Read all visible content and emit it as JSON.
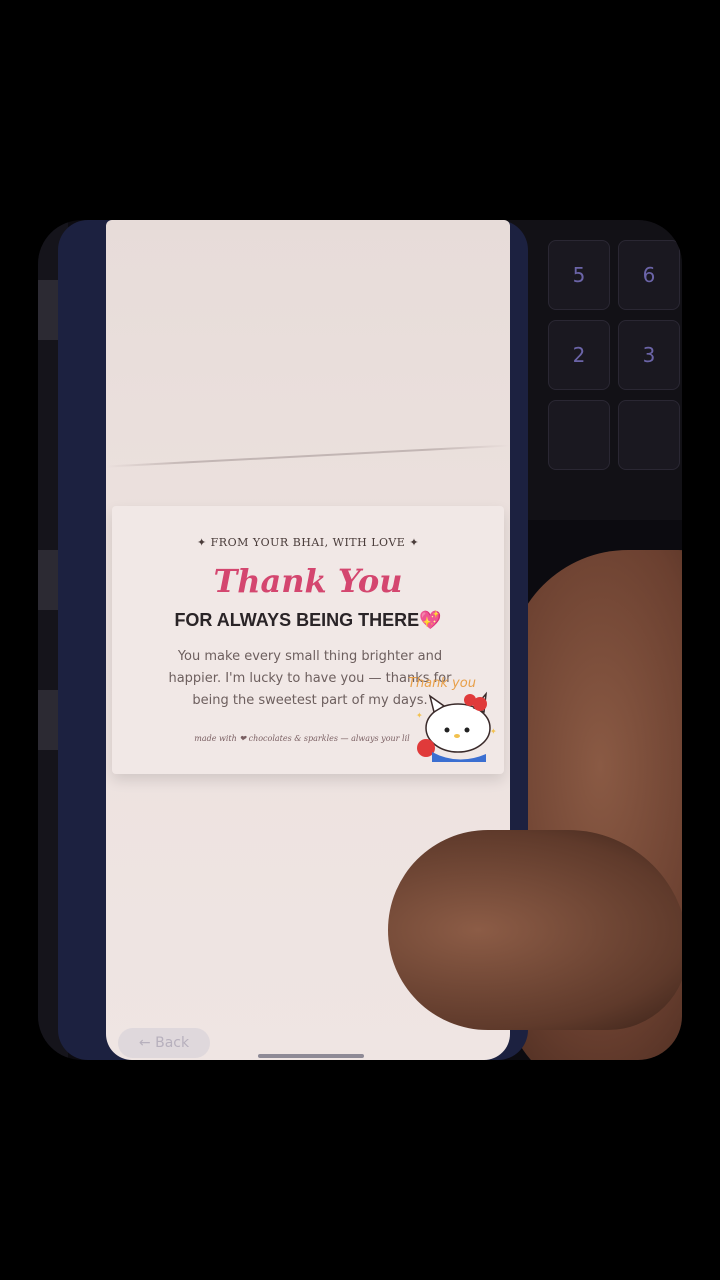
{
  "keyboard": {
    "keys": [
      "5",
      "6",
      "2",
      "3",
      "",
      ""
    ]
  },
  "card": {
    "top_line": "✦ FROM YOUR BHAI, WITH LOVE ✦",
    "title": "Thank You",
    "subtitle": "FOR ALWAYS BEING THERE",
    "subtitle_emoji": "💖",
    "body": "You make every small thing brighter and happier. I'm lucky to have you — thanks for being the sweetest part of my days.",
    "signoff": "made with ❤ chocolates & sparkles — always your lil"
  },
  "sticker": {
    "text": "Thank you",
    "icon": "hello-kitty-sticker-icon"
  },
  "nav": {
    "back_label": "← Back"
  },
  "colors": {
    "accent": "#d4466f",
    "heading": "#2a2427",
    "card_bg": "#f1e8e6"
  }
}
